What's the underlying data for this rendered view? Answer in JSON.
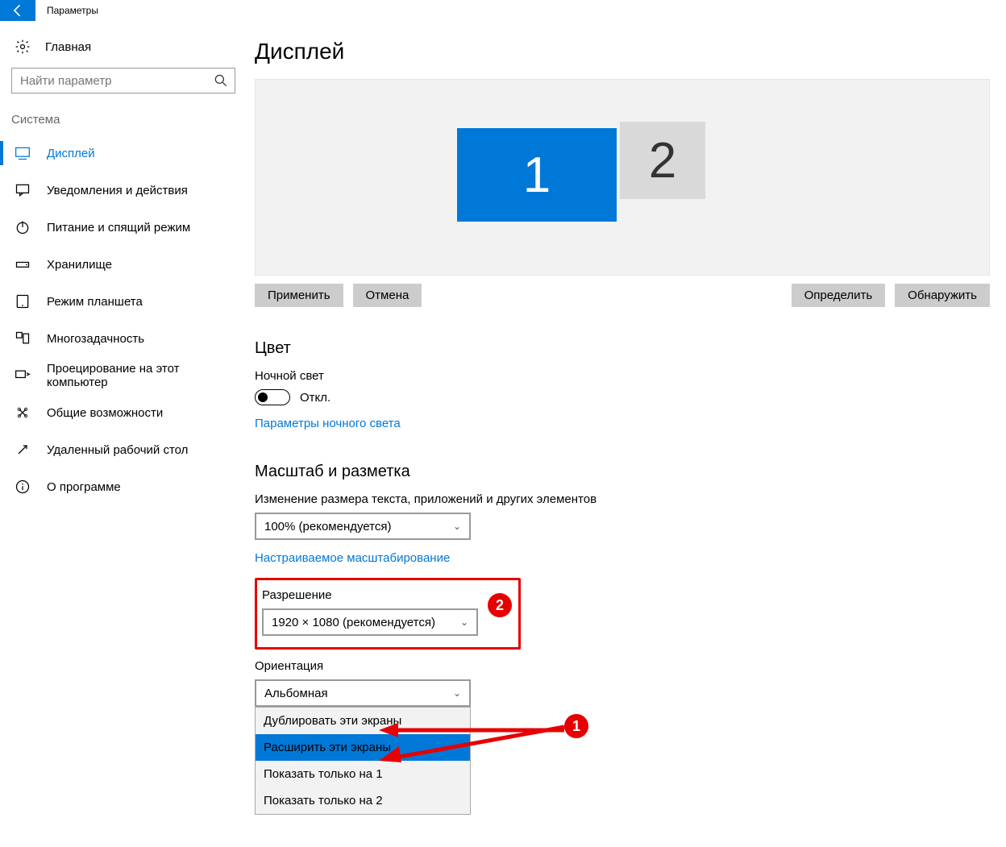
{
  "titlebar": {
    "title": "Параметры"
  },
  "sidebar": {
    "home": "Главная",
    "search_placeholder": "Найти параметр",
    "section": "Система",
    "items": [
      {
        "label": "Дисплей",
        "active": true
      },
      {
        "label": "Уведомления и действия"
      },
      {
        "label": "Питание и спящий режим"
      },
      {
        "label": "Хранилище"
      },
      {
        "label": "Режим планшета"
      },
      {
        "label": "Многозадачность"
      },
      {
        "label": "Проецирование на этот компьютер"
      },
      {
        "label": "Общие возможности"
      },
      {
        "label": "Удаленный рабочий стол"
      },
      {
        "label": "О программе"
      }
    ]
  },
  "main": {
    "page_title": "Дисплей",
    "monitors": {
      "m1": "1",
      "m2": "2"
    },
    "buttons": {
      "apply": "Применить",
      "cancel": "Отмена",
      "identify": "Определить",
      "detect": "Обнаружить"
    },
    "color": {
      "title": "Цвет",
      "night_light_label": "Ночной свет",
      "toggle_state": "Откл.",
      "night_light_link": "Параметры ночного света"
    },
    "scale": {
      "title": "Масштаб и разметка",
      "size_label": "Изменение размера текста, приложений и других элементов",
      "size_value": "100% (рекомендуется)",
      "custom_link": "Настраиваемое масштабирование",
      "resolution_label": "Разрешение",
      "resolution_value": "1920 × 1080 (рекомендуется)",
      "orientation_label": "Ориентация",
      "orientation_value": "Альбомная"
    },
    "popup": {
      "items": [
        "Дублировать эти экраны",
        "Расширить эти экраны",
        "Показать только на 1",
        "Показать только на 2"
      ],
      "selected_index": 1
    }
  },
  "callouts": {
    "c1": "1",
    "c2": "2"
  }
}
